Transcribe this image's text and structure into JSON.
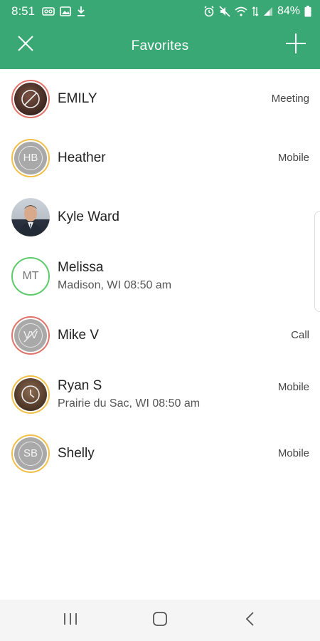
{
  "status_bar": {
    "time": "8:51",
    "battery": "84%"
  },
  "toolbar": {
    "title": "Favorites",
    "close_icon": "close-icon",
    "add_icon": "plus-icon"
  },
  "favorites": [
    {
      "name": "EMILY",
      "sub": "",
      "status": "Meeting",
      "avatar": "photo",
      "ring": "#e0736a",
      "initials": ""
    },
    {
      "name": "Heather",
      "sub": "",
      "status": "Mobile",
      "avatar": "initials-grey",
      "ring": "#f2c04a",
      "initials": "HB"
    },
    {
      "name": "Kyle Ward",
      "sub": "",
      "status": "",
      "avatar": "photo",
      "ring": "",
      "initials": ""
    },
    {
      "name": "Melissa",
      "sub": "Madison, WI 08:50 am",
      "status": "",
      "avatar": "initials-white",
      "ring": "#5ccb6b",
      "initials": "MT"
    },
    {
      "name": "Mike V",
      "sub": "",
      "status": "Call",
      "avatar": "initials-grey",
      "ring": "#e0736a",
      "initials": "VV"
    },
    {
      "name": "Ryan S",
      "sub": "Prairie du Sac, WI 08:50 am",
      "status": "Mobile",
      "avatar": "photo",
      "ring": "#f2c04a",
      "initials": ""
    },
    {
      "name": "Shelly",
      "sub": "",
      "status": "Mobile",
      "avatar": "initials-grey",
      "ring": "#f2c04a",
      "initials": "SB"
    }
  ],
  "nav_bar": {
    "recents_icon": "recents-icon",
    "home_icon": "home-icon",
    "back_icon": "back-icon"
  },
  "colors": {
    "header": "#3aa874",
    "ring_red": "#e0736a",
    "ring_yellow": "#f2c04a",
    "ring_green": "#5ccb6b"
  }
}
